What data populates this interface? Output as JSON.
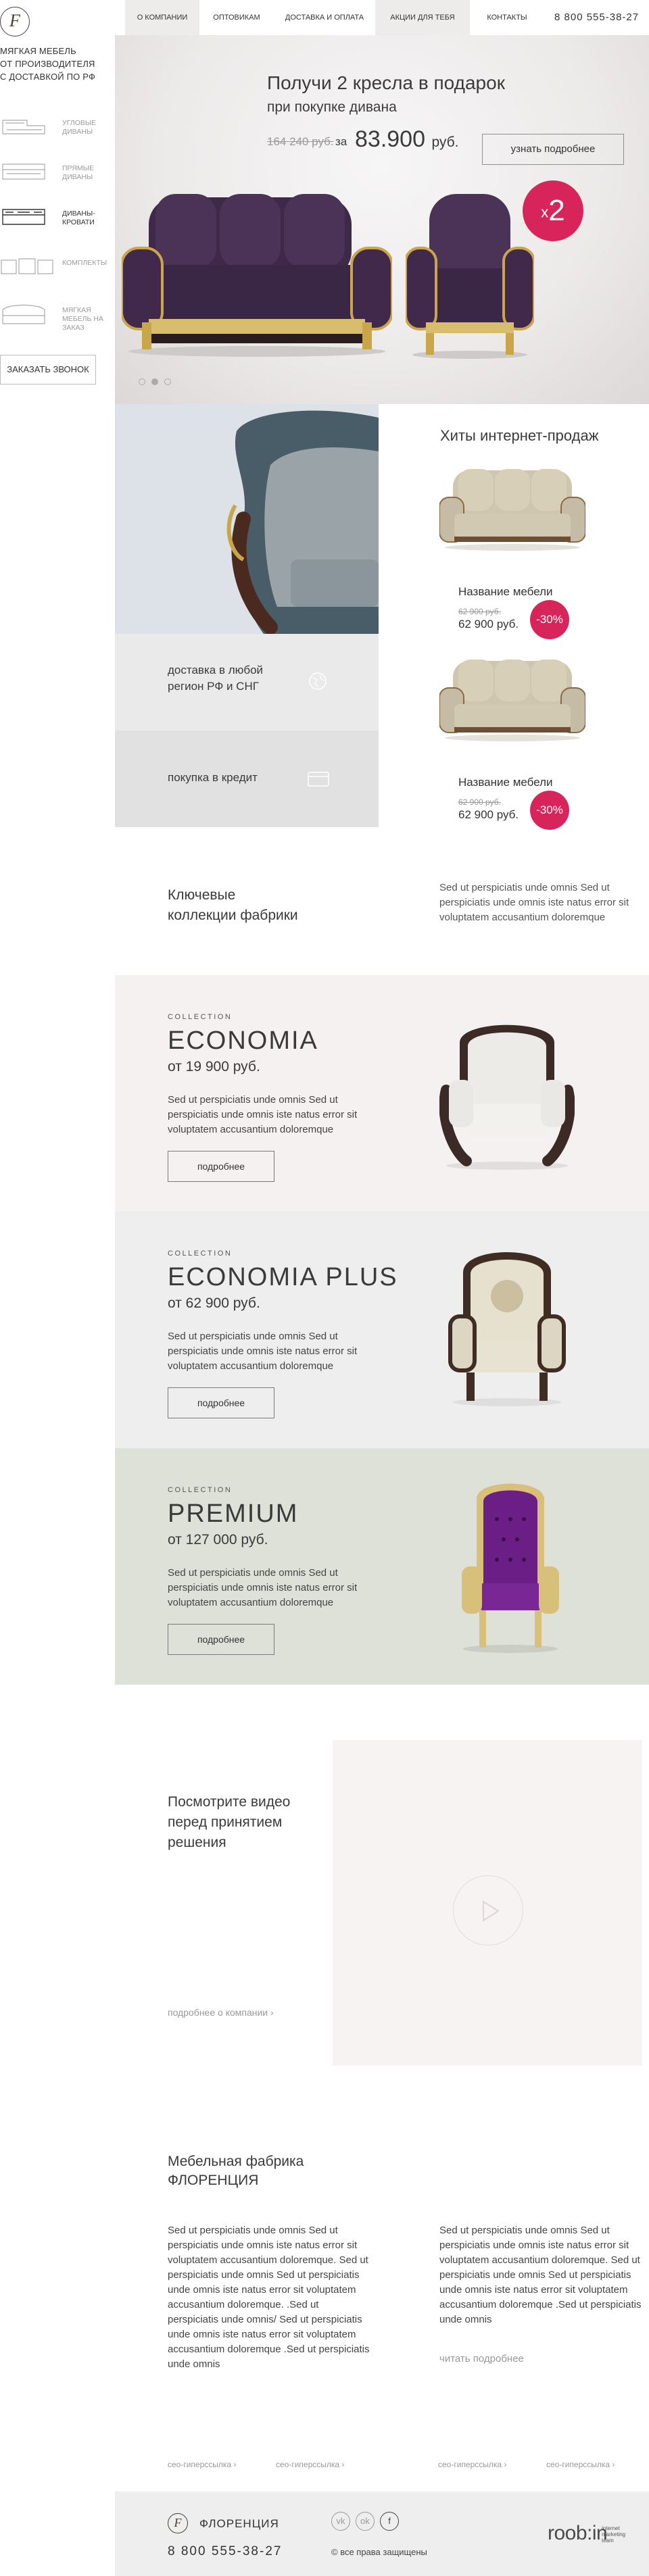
{
  "sidebar": {
    "tagline": [
      "мягкая мебель",
      "от производителя",
      "с доставкой по РФ"
    ],
    "categories": [
      {
        "label": "угловые диваны"
      },
      {
        "label": "прямые диваны"
      },
      {
        "label": "диваны-кровати"
      },
      {
        "label": "комплекты"
      },
      {
        "label": "мягкая мебель на заказ"
      }
    ],
    "call_button": "заказать звонок"
  },
  "nav": {
    "items": [
      "о компании",
      "оптовикам",
      "доставка и оплата",
      "акции для тебя",
      "контакты"
    ],
    "phone": "8 800 555-38-27"
  },
  "hero": {
    "title": "Получи 2 кресла в подарок",
    "subtitle": "при покупке дивана",
    "old_price": "164 240 руб.",
    "price_prefix": "за",
    "price": "83.900",
    "price_unit": "руб.",
    "button": "узнать подробнее",
    "badge_x": "x",
    "badge_num": "2"
  },
  "info": {
    "delivery": [
      "доставка в любой",
      "регион РФ и СНГ"
    ],
    "credit": "покупка в кредит"
  },
  "hits": {
    "title": "Хиты интернет-продаж",
    "products": [
      {
        "name": "Название мебели",
        "old_price": "62 900 руб.",
        "price": "62 900 руб.",
        "discount": "-30%"
      },
      {
        "name": "Название мебели",
        "old_price": "62 900 руб.",
        "price": "62 900 руб.",
        "discount": "-30%"
      }
    ]
  },
  "key": {
    "title": [
      "Ключевые",
      "коллекции фабрики"
    ],
    "desc": "Sed ut perspiciatis unde omnis Sed ut perspiciatis unde omnis iste natus error sit voluptatem accusantium doloremque"
  },
  "collections": [
    {
      "label": "COLLECTION",
      "title": "ECONOMIA",
      "price": "от 19 900 руб.",
      "desc": "Sed ut perspiciatis unde omnis Sed ut perspiciatis unde omnis iste natus error sit voluptatem accusantium doloremque",
      "button": "подробнее",
      "bg": "#f5f1f1"
    },
    {
      "label": "COLLECTION",
      "title": "ECONOMIA  PLUS",
      "price": "от 62 900 руб.",
      "desc": "Sed ut perspiciatis unde omnis Sed ut perspiciatis unde omnis iste natus error sit voluptatem accusantium doloremque",
      "button": "подробнее",
      "bg": "#eeeeee"
    },
    {
      "label": "COLLECTION",
      "title": "PREMIUM",
      "price": "от 127 000 руб.",
      "desc": "Sed ut perspiciatis unde omnis Sed ut perspiciatis unde omnis iste natus error sit voluptatem accusantium doloremque",
      "button": "подробнее",
      "bg": "#dde1d8"
    }
  ],
  "video": {
    "title": [
      "Посмотрите видео",
      "перед принятием",
      "решения"
    ],
    "link": "подробнее о компании ›"
  },
  "factory": {
    "title": [
      "Мебельная фабрика",
      "ФЛОРЕНЦИЯ"
    ],
    "col1": "Sed ut perspiciatis unde omnis Sed ut perspiciatis unde omnis iste natus error sit voluptatem accusantium doloremque. Sed ut perspiciatis unde omnis Sed ut perspiciatis unde omnis iste natus error sit voluptatem accusantium doloremque. .Sed ut perspiciatis unde omnis/ Sed ut perspiciatis unde omnis iste natus error sit voluptatem accusantium doloremque .Sed ut perspiciatis unde omnis",
    "col2": "Sed ut perspiciatis unde omnis Sed ut perspiciatis unde omnis iste natus error sit voluptatem accusantium doloremque. Sed ut perspiciatis unde omnis Sed ut perspiciatis unde omnis iste natus error sit voluptatem accusantium doloremque .Sed ut perspiciatis unde omnis",
    "more": "читать подробнее"
  },
  "seo_links": [
    "сео-гиперссылка ›",
    "сео-гиперссылка ›",
    "сео-гиперссылка ›",
    "сео-гиперссылка ›"
  ],
  "footer": {
    "brand": "ФЛОРЕНЦИЯ",
    "phone": "8 800 555-38-27",
    "copyright": "© все права защищены",
    "social": [
      "vk",
      "ok",
      "f"
    ],
    "dev_logo": "roob:in",
    "dev_text": [
      "internet",
      "marketing",
      "team"
    ]
  },
  "colors": {
    "accent": "#d7255b",
    "text": "#3a3a3a",
    "muted": "#9a9a9a"
  }
}
